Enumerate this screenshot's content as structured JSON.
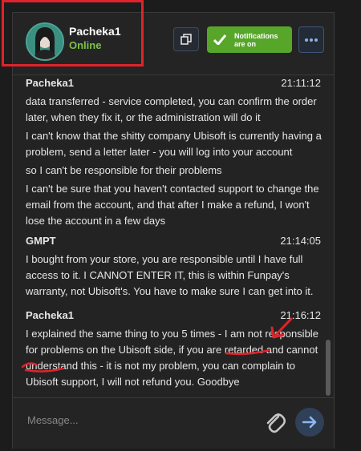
{
  "chat": {
    "user": {
      "name": "Pacheka1",
      "status": "Online"
    },
    "notifications_label_line1": "Notifications",
    "notifications_label_line2": "are on",
    "messages": [
      {
        "author": "Pacheka1",
        "time": "21:11:12",
        "lines": [
          "data transferred - service completed, you can confirm the order later, when they fix it, or the administration will do it",
          "I can't know that the shitty company Ubisoft is currently having a problem, send a letter later - you will log into your account",
          "so I can't be responsible for their problems",
          "I can't be sure that you haven't contacted support to change the email from the account, and that after I make a refund, I won't lose the account in a few days"
        ]
      },
      {
        "author": "GMPT",
        "time": "21:14:05",
        "lines": [
          "I bought from your store, you are responsible until I have full access to it. I CANNOT ENTER IT, this is within Funpay's warranty, not Ubisoft's. You have to make sure I can get into it."
        ]
      },
      {
        "author": "Pacheka1",
        "time": "21:16:12",
        "lines": [
          "I explained the same thing to you 5 times - I am not responsible for problems on the Ubisoft side, if you are retarded and cannot understand this - it is not my problem, you can complain to Ubisoft support, I will not refund you. Goodbye"
        ]
      }
    ],
    "composer": {
      "placeholder": "Message..."
    }
  },
  "colors": {
    "online": "#7cc04a",
    "notifications_button": "#57a62a",
    "annotation": "#e0232a"
  }
}
